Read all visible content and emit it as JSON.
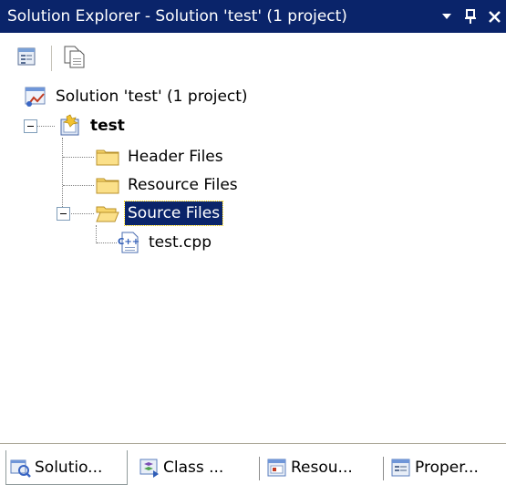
{
  "window": {
    "title": "Solution Explorer - Solution 'test' (1 project)",
    "controls": {
      "dropdown": "▾",
      "pin": "ᵖ",
      "close": "✕"
    }
  },
  "toolbar": {
    "buttons": [
      {
        "name": "properties-button",
        "icon": "properties-icon"
      },
      {
        "name": "show-all-files-button",
        "icon": "show-all-files-icon"
      }
    ]
  },
  "tree": {
    "solution": {
      "label": "Solution 'test' (1 project)",
      "icon": "solution-icon"
    },
    "project": {
      "label": "test",
      "icon": "project-icon",
      "expanded": true
    },
    "folders": [
      {
        "label": "Header Files",
        "icon": "folder-closed-icon"
      },
      {
        "label": "Resource Files",
        "icon": "folder-closed-icon"
      },
      {
        "label": "Source Files",
        "icon": "folder-open-icon",
        "expanded": true,
        "selected": true
      }
    ],
    "files": [
      {
        "label": "test.cpp",
        "icon": "cpp-file-icon"
      }
    ]
  },
  "tabs": [
    {
      "label": "Solutio...",
      "icon": "solution-explorer-icon",
      "active": true
    },
    {
      "label": "Class ...",
      "icon": "class-view-icon",
      "active": false
    },
    {
      "label": "Resou...",
      "icon": "resource-view-icon",
      "active": false
    },
    {
      "label": "Proper...",
      "icon": "property-manager-icon",
      "active": false
    }
  ],
  "colors": {
    "titlebar": "#0a246a",
    "selection": "#0a246a",
    "folder": "#f7d56b"
  }
}
